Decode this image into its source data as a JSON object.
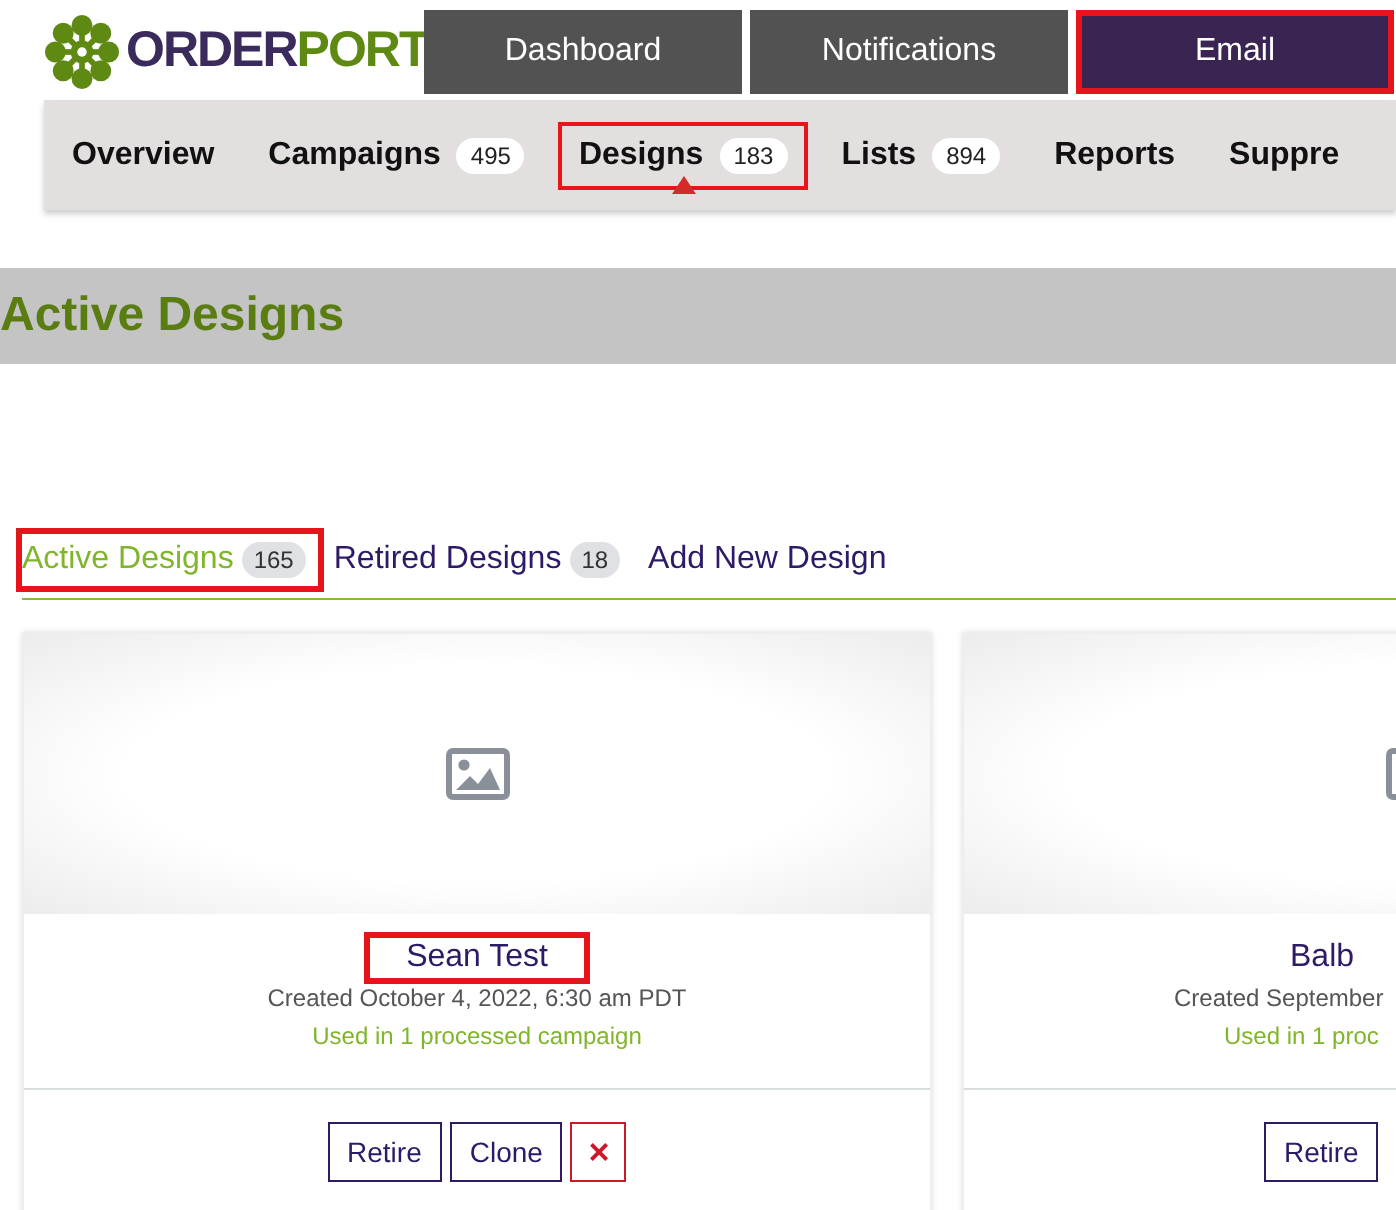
{
  "logo": {
    "text_parts": [
      "ORDER",
      "PORT"
    ]
  },
  "top_nav": [
    {
      "label": "Dashboard",
      "selected": false,
      "highlighted": false
    },
    {
      "label": "Notifications",
      "selected": false,
      "highlighted": false
    },
    {
      "label": "Email",
      "selected": true,
      "highlighted": true
    }
  ],
  "sub_nav": [
    {
      "label": "Overview",
      "selected": false,
      "highlighted": false
    },
    {
      "label": "Campaigns",
      "badge": "495",
      "selected": false,
      "highlighted": false
    },
    {
      "label": "Designs",
      "badge": "183",
      "selected": true,
      "highlighted": true
    },
    {
      "label": "Lists",
      "badge": "894",
      "selected": false,
      "highlighted": false
    },
    {
      "label": "Reports",
      "selected": false,
      "highlighted": false
    },
    {
      "label": "Suppre",
      "selected": false,
      "highlighted": false
    }
  ],
  "page_title": "Active Designs",
  "tabs": [
    {
      "label": "Active Designs",
      "badge": "165",
      "selected": true,
      "highlighted": true
    },
    {
      "label": "Retired Designs",
      "badge": "18",
      "selected": false,
      "highlighted": false
    },
    {
      "label": "Add New Design",
      "selected": false,
      "highlighted": false
    }
  ],
  "cards": [
    {
      "name": "Sean Test",
      "name_highlighted": true,
      "created": "Created October 4, 2022, 6:30 am PDT",
      "usage": "Used in 1 processed campaign",
      "buttons": [
        {
          "kind": "retire",
          "label": "Retire"
        },
        {
          "kind": "clone",
          "label": "Clone"
        },
        {
          "kind": "delete",
          "label": "×"
        }
      ]
    },
    {
      "name": "Balb",
      "name_highlighted": false,
      "created": "Created September",
      "usage": "Used in 1 proc",
      "buttons": [
        {
          "kind": "retire",
          "label": "Retire"
        }
      ]
    }
  ]
}
